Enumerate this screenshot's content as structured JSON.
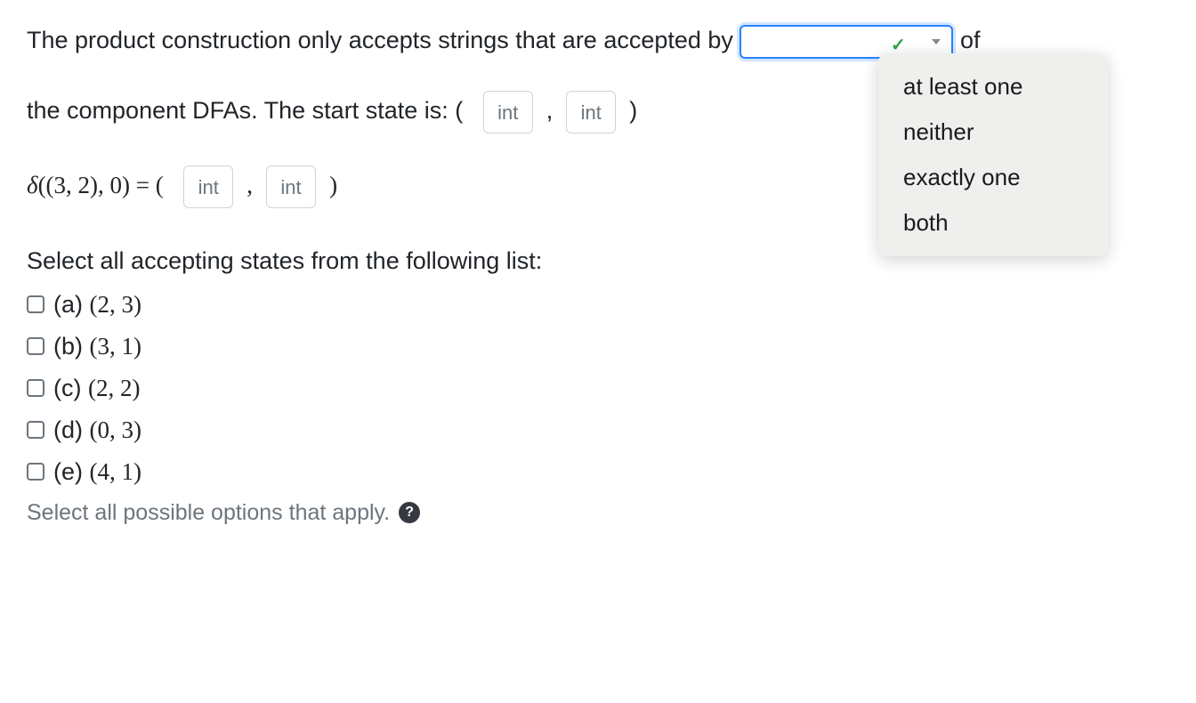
{
  "question": {
    "part1": "The product construction only accepts strings that are accepted by",
    "part2": "of",
    "part3": "the component DFAs. The start state is: (",
    "comma": ",",
    "closeParen": ")"
  },
  "dropdown": {
    "options": [
      "at least one",
      "neither",
      "exactly one",
      "both"
    ]
  },
  "input": {
    "placeholder": "int"
  },
  "delta": {
    "prefix": "δ",
    "args": "((3, 2), 0) = (",
    "comma": ",",
    "closeParen": ")"
  },
  "accepting": {
    "heading": "Select all accepting states from the following list:",
    "options": [
      {
        "letter": "(a)",
        "pair": "(2, 3)"
      },
      {
        "letter": "(b)",
        "pair": "(3, 1)"
      },
      {
        "letter": "(c)",
        "pair": "(2, 2)"
      },
      {
        "letter": "(d)",
        "pair": "(0, 3)"
      },
      {
        "letter": "(e)",
        "pair": "(4, 1)"
      }
    ],
    "hint": "Select all possible options that apply."
  }
}
